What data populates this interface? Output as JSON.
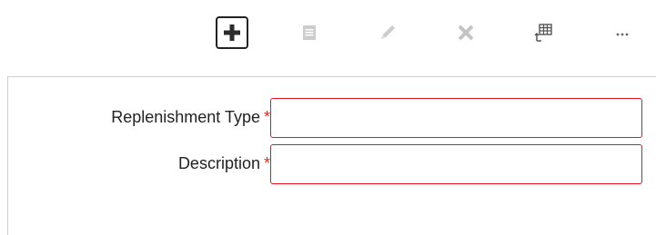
{
  "toolbar": {
    "buttons": [
      {
        "name": "add-button",
        "icon": "plus-icon",
        "state": "focused"
      },
      {
        "name": "copy-button",
        "icon": "copy-icon",
        "state": "disabled"
      },
      {
        "name": "edit-button",
        "icon": "pencil-icon",
        "state": "disabled"
      },
      {
        "name": "delete-button",
        "icon": "close-icon",
        "state": "disabled"
      },
      {
        "name": "export-grid-button",
        "icon": "table-export-icon",
        "state": "enabled"
      },
      {
        "name": "more-button",
        "icon": "ellipsis-icon",
        "state": "enabled"
      }
    ]
  },
  "form": {
    "replenishment_type": {
      "label": "Replenishment Type",
      "required_marker": "*",
      "value": ""
    },
    "description": {
      "label": "Description",
      "required_marker": "*",
      "value": ""
    }
  },
  "colors": {
    "error_border": "#e8131b",
    "required_star": "#d93025",
    "disabled_icon": "#c8c8c8"
  }
}
